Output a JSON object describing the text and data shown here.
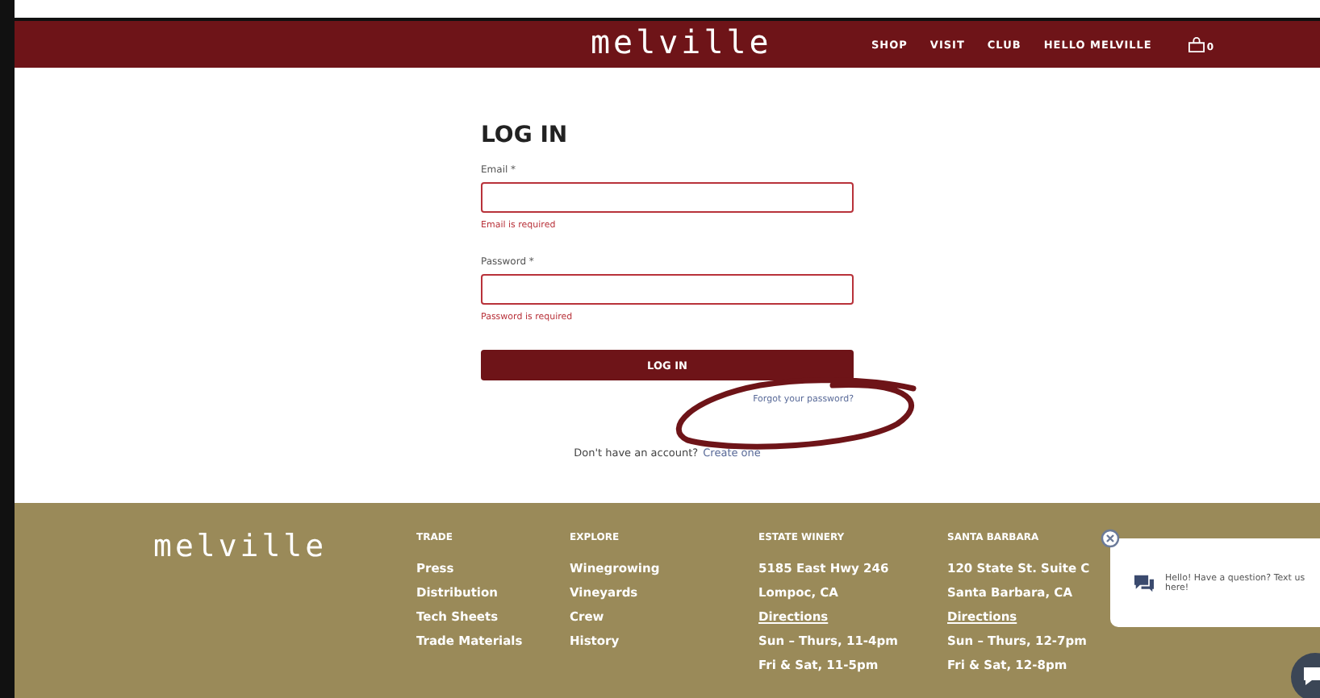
{
  "header": {
    "logo": "melville",
    "nav": [
      {
        "label": "SHOP"
      },
      {
        "label": "VISIT"
      },
      {
        "label": "CLUB"
      },
      {
        "label": "HELLO MELVILLE"
      }
    ],
    "cart_count": "0"
  },
  "login": {
    "title": "LOG IN",
    "fields": [
      {
        "label": "Email",
        "required": "*",
        "error": "Email is required"
      },
      {
        "label": "Password",
        "required": "*",
        "error": "Password is required"
      }
    ],
    "button": "LOG IN",
    "forgot": "Forgot your password?",
    "signup_prompt": "Don't have an account?",
    "signup_link": "Create one"
  },
  "footer": {
    "logo": "melville",
    "columns": [
      {
        "heading": "TRADE",
        "items": [
          {
            "text": "Press"
          },
          {
            "text": "Distribution"
          },
          {
            "text": "Tech Sheets"
          },
          {
            "text": "Trade Materials"
          }
        ]
      },
      {
        "heading": "EXPLORE",
        "items": [
          {
            "text": "Winegrowing"
          },
          {
            "text": "Vineyards"
          },
          {
            "text": "Crew"
          },
          {
            "text": "History"
          }
        ]
      },
      {
        "heading": "ESTATE WINERY",
        "items": [
          {
            "text": "5185 East Hwy 246"
          },
          {
            "text": "Lompoc, CA"
          },
          {
            "text": "Directions",
            "link": true
          },
          {
            "text": "Sun – Thurs, 11-4pm"
          },
          {
            "text": "Fri & Sat, 11-5pm"
          }
        ]
      },
      {
        "heading": "SANTA BARBARA",
        "items": [
          {
            "text": "120 State St. Suite C"
          },
          {
            "text": "Santa Barbara, CA"
          },
          {
            "text": "Directions",
            "link": true
          },
          {
            "text": "Sun – Thurs, 12-7pm"
          },
          {
            "text": "Fri & Sat, 12-8pm"
          }
        ]
      }
    ]
  },
  "chat": {
    "message": "Hello! Have a question? Text us here!"
  }
}
